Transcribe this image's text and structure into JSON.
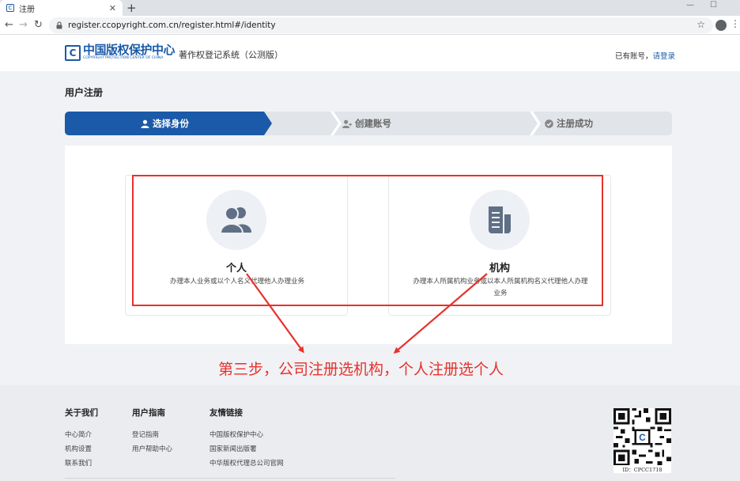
{
  "browser": {
    "tab_title": "注册",
    "tab_favicon": "C",
    "url": "register.ccopyright.com.cn/register.html#/identity"
  },
  "header": {
    "logo_mark": "C",
    "logo_cn": "中国版权保护中心",
    "logo_en": "COPYRIGHT PROTECTION CENTER OF CHINA",
    "system_name": "著作权登记系统（公测版）",
    "account_prompt": "已有账号，",
    "login_link": "请登录"
  },
  "page": {
    "title": "用户注册"
  },
  "steps": [
    {
      "label": "选择身份",
      "icon": "person-icon",
      "active": true
    },
    {
      "label": "创建账号",
      "icon": "user-add-icon",
      "active": false
    },
    {
      "label": "注册成功",
      "icon": "check-circle-icon",
      "active": false
    }
  ],
  "identity_options": [
    {
      "title": "个人",
      "description": "办理本人业务或以个人名义代理他人办理业务",
      "icon": "users-icon"
    },
    {
      "title": "机构",
      "description": "办理本人所属机构业务或以本人所属机构名义代理他人办理业务",
      "icon": "document-icon"
    }
  ],
  "annotation": {
    "text": "第三步，公司注册选机构，个人注册选个人"
  },
  "footer": {
    "columns": [
      {
        "heading": "关于我们",
        "links": [
          "中心简介",
          "机构设置",
          "联系我们"
        ]
      },
      {
        "heading": "用户指南",
        "links": [
          "登记指南",
          "用户帮助中心"
        ]
      },
      {
        "heading": "友情链接",
        "links": [
          "中国版权保护中心",
          "国家新闻出版署",
          "中华版权代理总公司官网"
        ]
      }
    ],
    "qr_caption": "ID：CPCC1718"
  },
  "colors": {
    "brand_blue": "#1a5aa8",
    "annotation_red": "#e8312c",
    "step_inactive": "#e1e4e8"
  }
}
